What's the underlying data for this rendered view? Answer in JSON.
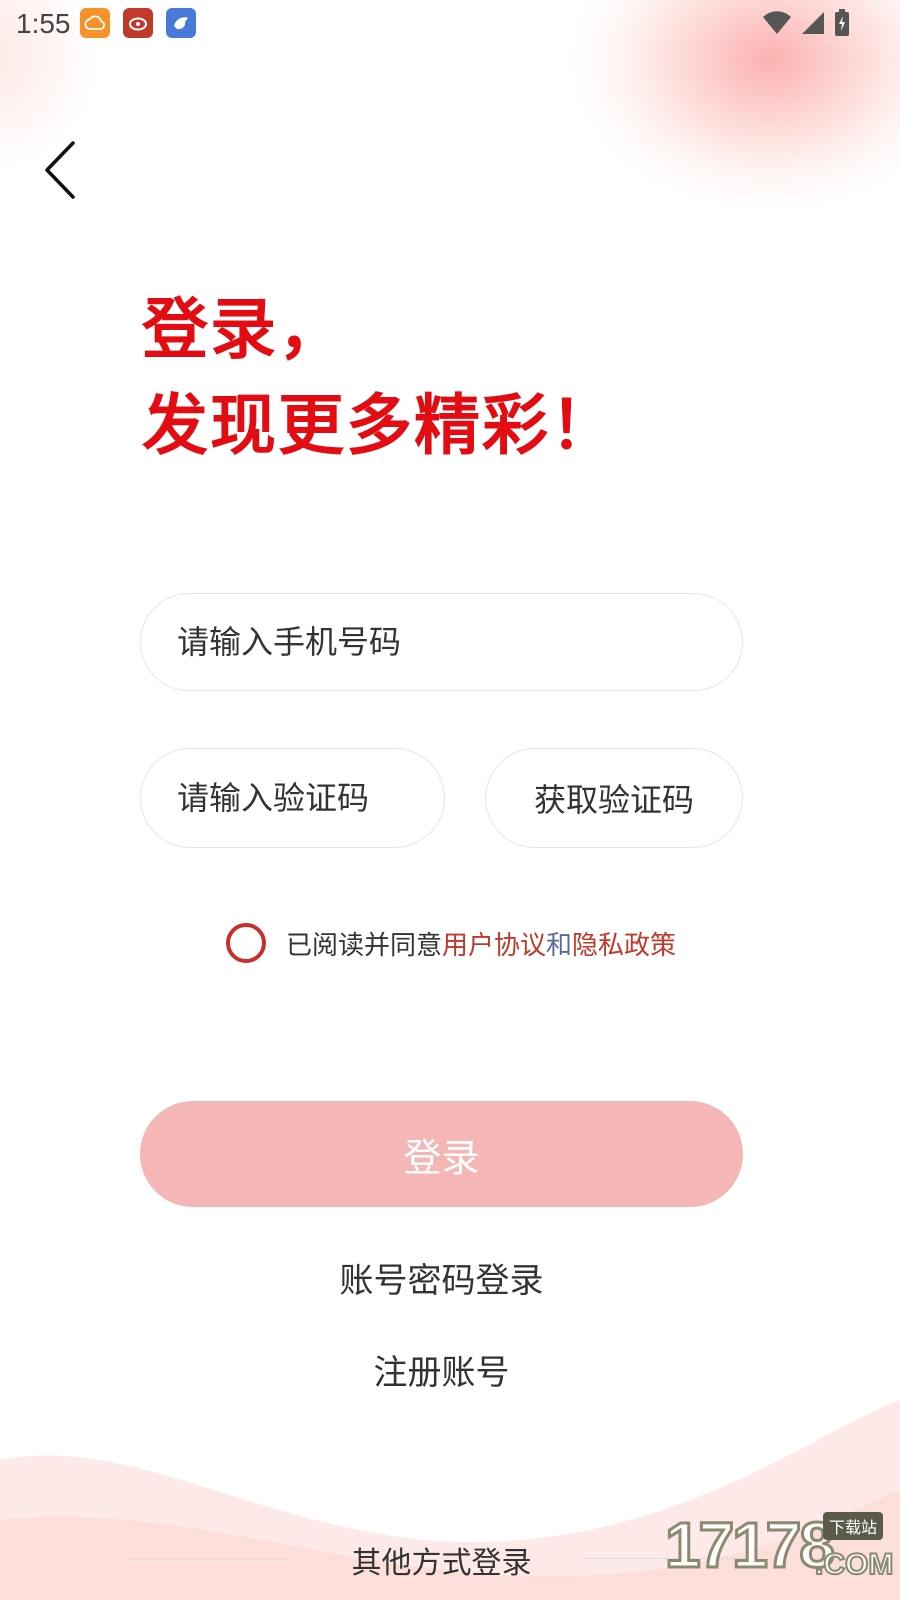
{
  "status_bar": {
    "time": "1:55",
    "notification_icons": [
      "weather-cloud-icon",
      "weibo-icon",
      "bird-app-icon"
    ],
    "system_icons": [
      "wifi-icon",
      "signal-icon",
      "battery-charging-icon"
    ]
  },
  "nav": {
    "back_icon": "chevron-left-icon"
  },
  "headline": {
    "line1": "登录，",
    "line2": "发现更多精彩！"
  },
  "form": {
    "phone_placeholder": "请输入手机号码",
    "code_placeholder": "请输入验证码",
    "get_code_label": "获取验证码"
  },
  "agreement": {
    "prefix": "已阅读并同意",
    "user_agreement": "用户协议",
    "and": "和",
    "privacy_policy": "隐私政策",
    "checked": false
  },
  "actions": {
    "login_label": "登录",
    "password_login_label": "账号密码登录",
    "register_label": "注册账号",
    "other_login_label": "其他方式登录"
  },
  "watermark": {
    "number": "17178",
    "badge": "下载站",
    "suffix": ".COM"
  },
  "colors": {
    "brand_red": "#e30c12",
    "login_button_disabled": "#f4b7b5",
    "agreement_link": "#c0392b",
    "agreement_and": "#5a6a9a"
  }
}
